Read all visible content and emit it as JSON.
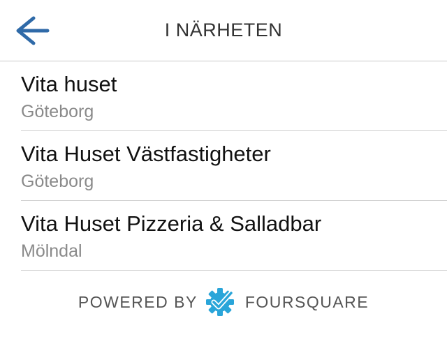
{
  "header": {
    "title": "I NÄRHETEN",
    "back_icon": "arrow-left-icon",
    "accent_color": "#2f6aa8"
  },
  "places": [
    {
      "name": "Vita huset",
      "city": "Göteborg"
    },
    {
      "name": "Vita Huset Västfastigheter",
      "city": "Göteborg"
    },
    {
      "name": "Vita Huset Pizzeria & Salladbar",
      "city": "Mölndal"
    }
  ],
  "footer": {
    "powered_by": "POWERED BY",
    "brand": "FOURSQUARE",
    "brand_color": "#2aa5d9",
    "logo_icon": "foursquare-check-gear-icon"
  }
}
